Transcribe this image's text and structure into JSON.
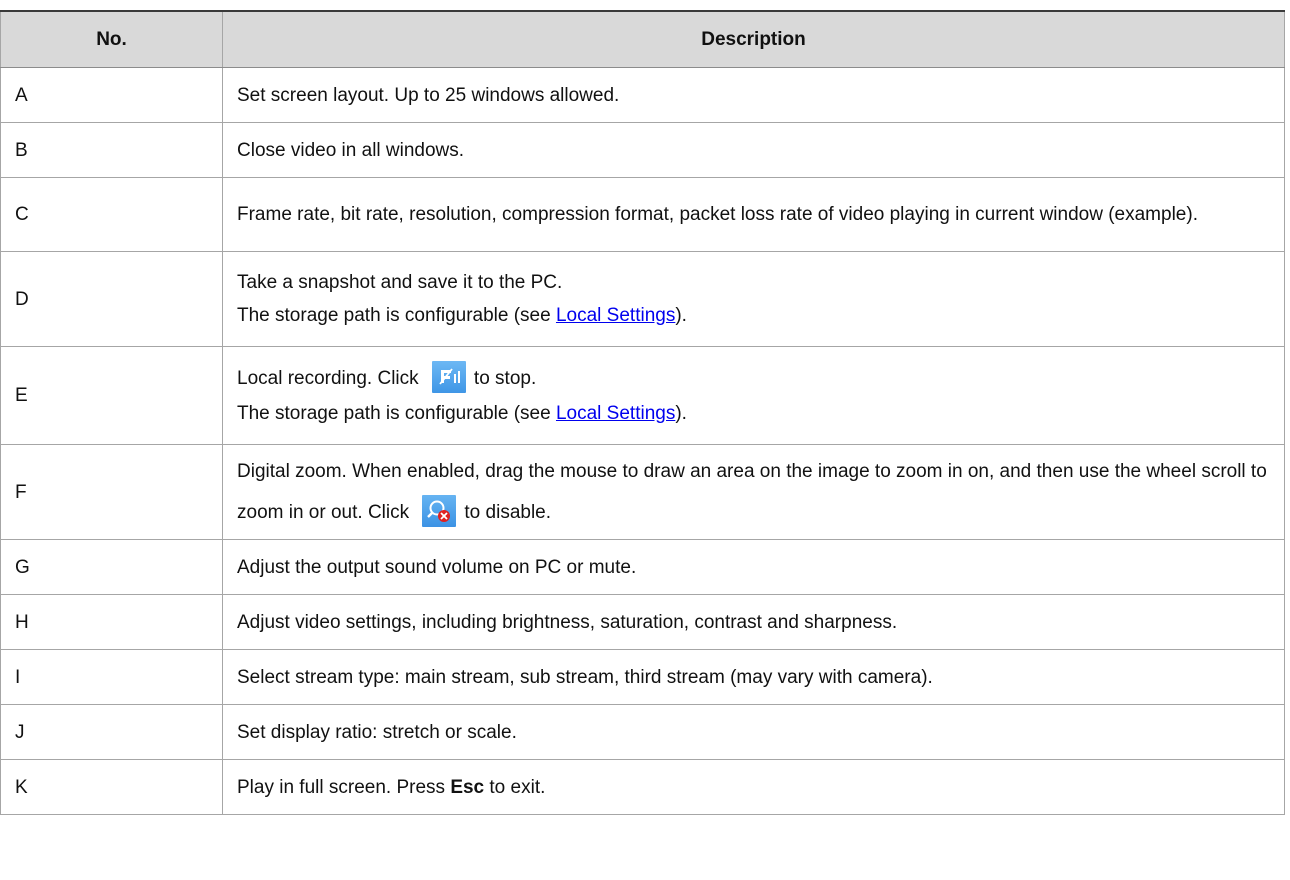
{
  "table": {
    "headers": [
      "No.",
      "Description"
    ],
    "rows": [
      {
        "no": "A",
        "desc": [
          "Set screen layout. Up to 25 windows allowed."
        ]
      },
      {
        "no": "B",
        "desc": [
          "Close video in all windows."
        ]
      },
      {
        "no": "C",
        "desc": [
          "Frame rate, bit rate, resolution, compression format, packet loss rate of video playing in current window (example)."
        ]
      },
      {
        "no": "D",
        "desc": [
          "Take a snapshot and save it to the PC.",
          "The storage path is configurable (see ",
          "Local Settings",
          ")."
        ]
      },
      {
        "no": "E",
        "desc": [
          "Local recording. Click ",
          "to stop.",
          "The storage path is configurable (see ",
          "Local Settings",
          ")."
        ]
      },
      {
        "no": "F",
        "desc": [
          "Digital zoom. When enabled, drag the mouse to draw an area on the image to zoom in on, and then use the wheel scroll to zoom in or out. Click ",
          "to disable."
        ]
      },
      {
        "no": "G",
        "desc": [
          "Adjust the output sound volume on PC or mute."
        ]
      },
      {
        "no": "H",
        "desc": [
          "Adjust video settings, including brightness, saturation, contrast and sharpness."
        ]
      },
      {
        "no": "I",
        "desc": [
          "Select stream type: main stream, sub stream, third stream (may vary with camera)."
        ]
      },
      {
        "no": "J",
        "desc": [
          "Set display ratio: stretch or scale."
        ]
      },
      {
        "no": "K",
        "desc": [
          "Play in full screen. Press ",
          "Esc",
          " to exit."
        ]
      }
    ]
  },
  "icons": {
    "stop_recording": "stop-recording-icon",
    "disable_zoom": "disable-zoom-icon"
  },
  "colors": {
    "header_bg": "#d9d9d9",
    "link": "#0000ee",
    "icon_blue": "#4a9fe8",
    "close_red": "#e02020"
  }
}
